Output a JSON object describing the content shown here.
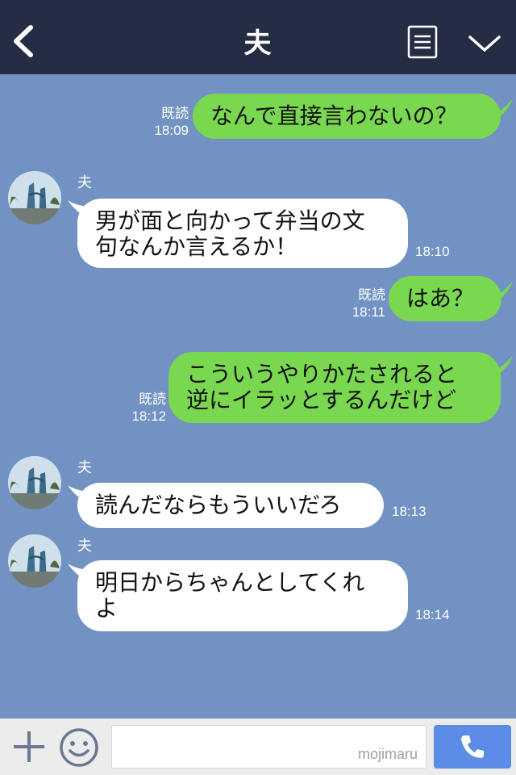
{
  "header": {
    "title": "夫",
    "back_icon": "chevron-left-icon",
    "menu_icon": "menu-lines-icon",
    "collapse_icon": "chevron-down-icon"
  },
  "messages": [
    {
      "side": "out",
      "text": "なんで直接言わないの？",
      "read": "既読",
      "time": "18:09"
    },
    {
      "side": "in",
      "sender": "夫",
      "line1": "男が面と向かって弁当の文",
      "line2": "句なんか言えるか！",
      "time": "18:10"
    },
    {
      "side": "out",
      "text": "はあ？",
      "read": "既読",
      "time": "18:11"
    },
    {
      "side": "out",
      "line1": "こういうやりかたされると",
      "line2": "逆にイラッとするんだけど",
      "read": "既読",
      "time": "18:12"
    },
    {
      "side": "in",
      "sender": "夫",
      "text": "読んだならもういいだろ",
      "time": "18:13"
    },
    {
      "side": "in",
      "sender": "夫",
      "line1": "明日からちゃんとしてくれ",
      "line2": "よ",
      "time": "18:14"
    }
  ],
  "input_bar": {
    "plus_icon": "plus-icon",
    "emoji_icon": "smiley-icon",
    "placeholder": "",
    "watermark": "mojimaru",
    "call_icon": "phone-icon"
  },
  "colors": {
    "header_bg": "#252d45",
    "chat_bg": "#7192c3",
    "outgoing_bubble": "#79d84f",
    "incoming_bubble": "#ffffff",
    "call_button": "#5b8de8"
  }
}
